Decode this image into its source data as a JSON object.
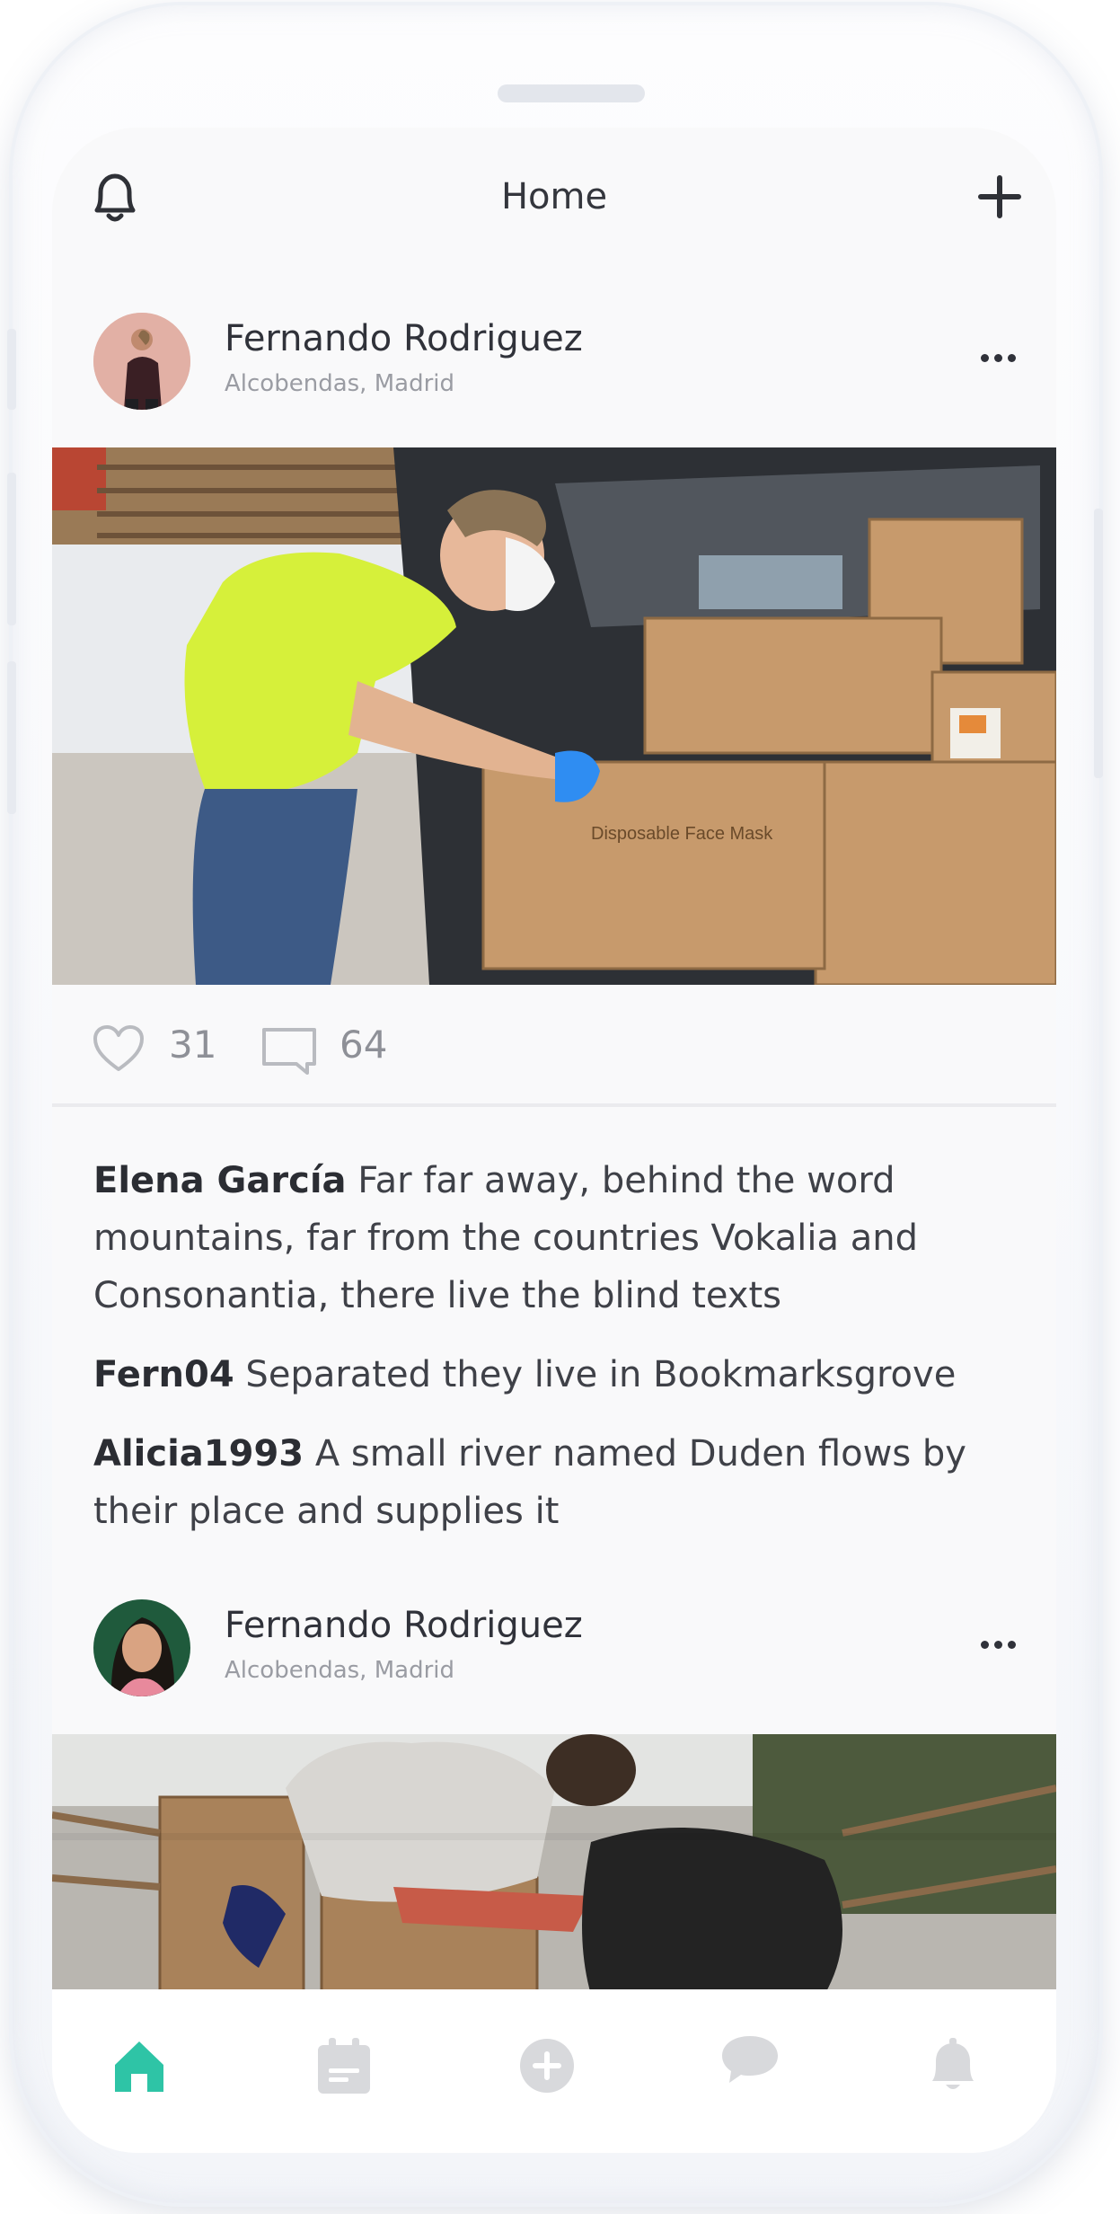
{
  "header": {
    "title": "Home"
  },
  "posts": [
    {
      "author": "Fernando Rodriguez",
      "location": "Alcobendas, Madrid",
      "likes": "31",
      "comments_count": "64",
      "photo_caption": "Disposable Face Mask",
      "comments": [
        {
          "user": "Elena García",
          "text": "Far far away, behind the word mountains, far from the countries Vokalia and Consonantia, there live the blind texts"
        },
        {
          "user": "Fern04",
          "text": "Separated they live in Bookmarksgrove"
        },
        {
          "user": "Alicia1993",
          "text": "A small river named Duden flows by their place and supplies it"
        }
      ]
    },
    {
      "author": "Fernando Rodriguez",
      "location": "Alcobendas, Madrid"
    }
  ],
  "tabbar": {
    "items": [
      {
        "icon": "home-icon",
        "active": true
      },
      {
        "icon": "calendar-icon",
        "active": false
      },
      {
        "icon": "add-circle-icon",
        "active": false
      },
      {
        "icon": "chat-icon",
        "active": false
      },
      {
        "icon": "bell-icon",
        "active": false
      }
    ]
  },
  "colors": {
    "accent": "#2ec4a6",
    "inactive": "#d8d9dc",
    "text": "#2b2d33",
    "muted": "#9a9ca3"
  }
}
